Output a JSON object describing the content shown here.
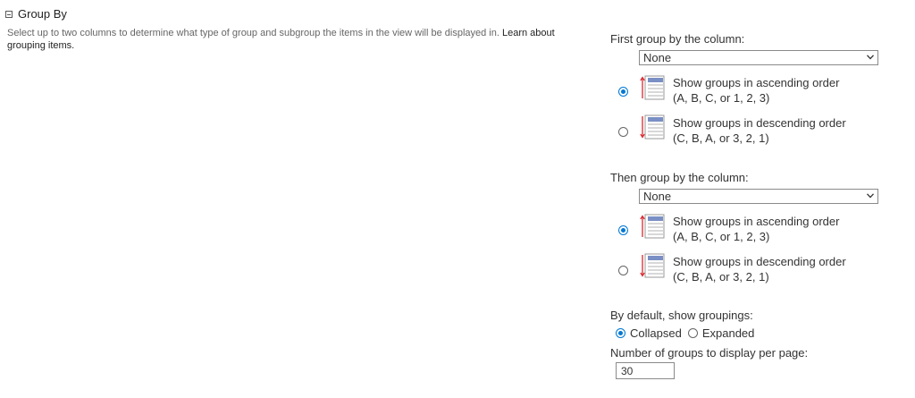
{
  "section": {
    "title": "Group By",
    "description": "Select up to two columns to determine what type of group and subgroup the items in the view will be displayed in.",
    "link_text": "Learn about grouping items."
  },
  "first_group": {
    "label": "First group by the column:",
    "selected": "None",
    "ascending": {
      "line1": "Show groups in ascending order",
      "line2": "(A, B, C, or 1, 2, 3)",
      "checked": true
    },
    "descending": {
      "line1": "Show groups in descending order",
      "line2": "(C, B, A, or 3, 2, 1)",
      "checked": false
    }
  },
  "then_group": {
    "label": "Then group by the column:",
    "selected": "None",
    "ascending": {
      "line1": "Show groups in ascending order",
      "line2": "(A, B, C, or 1, 2, 3)",
      "checked": true
    },
    "descending": {
      "line1": "Show groups in descending order",
      "line2": "(C, B, A, or 3, 2, 1)",
      "checked": false
    }
  },
  "default_groupings": {
    "label": "By default, show groupings:",
    "collapsed": "Collapsed",
    "expanded": "Expanded",
    "selected": "Collapsed"
  },
  "groups_per_page": {
    "label": "Number of groups to display per page:",
    "value": "30"
  },
  "colors": {
    "accent": "#0078d4",
    "arrow": "#d9282f",
    "icon_bar": "#7a8fc4"
  },
  "icons": [
    "collapse-icon",
    "chevron-down-icon",
    "sort-ascending-icon",
    "sort-descending-icon"
  ]
}
